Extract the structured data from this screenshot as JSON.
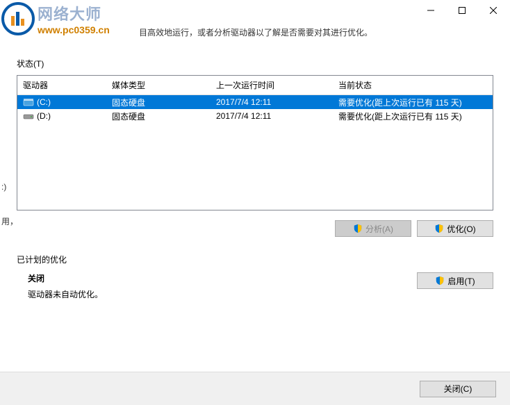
{
  "watermark": {
    "title": "网络大师",
    "url": "www.pc0359.cn"
  },
  "description": "目高效地运行，或者分析驱动器以了解是否需要对其进行优化。",
  "status_label": "状态(T)",
  "columns": {
    "drive": "驱动器",
    "media": "媒体类型",
    "last": "上一次运行时间",
    "status": "当前状态"
  },
  "rows": [
    {
      "drive": "(C:)",
      "media": "固态硬盘",
      "last": "2017/7/4 12:11",
      "status": "需要优化(距上次运行已有 115 天)",
      "selected": true
    },
    {
      "drive": "(D:)",
      "media": "固态硬盘",
      "last": "2017/7/4 12:11",
      "status": "需要优化(距上次运行已有 115 天)",
      "selected": false
    }
  ],
  "buttons": {
    "analyze": "分析(A)",
    "optimize": "优化(O)",
    "enable": "启用(T)",
    "close": "关闭(C)"
  },
  "schedule": {
    "label": "已计划的优化",
    "title": "关闭",
    "sub": "驱动器未自动优化。"
  },
  "fragments": {
    "d": ":)",
    "use": "用，"
  }
}
